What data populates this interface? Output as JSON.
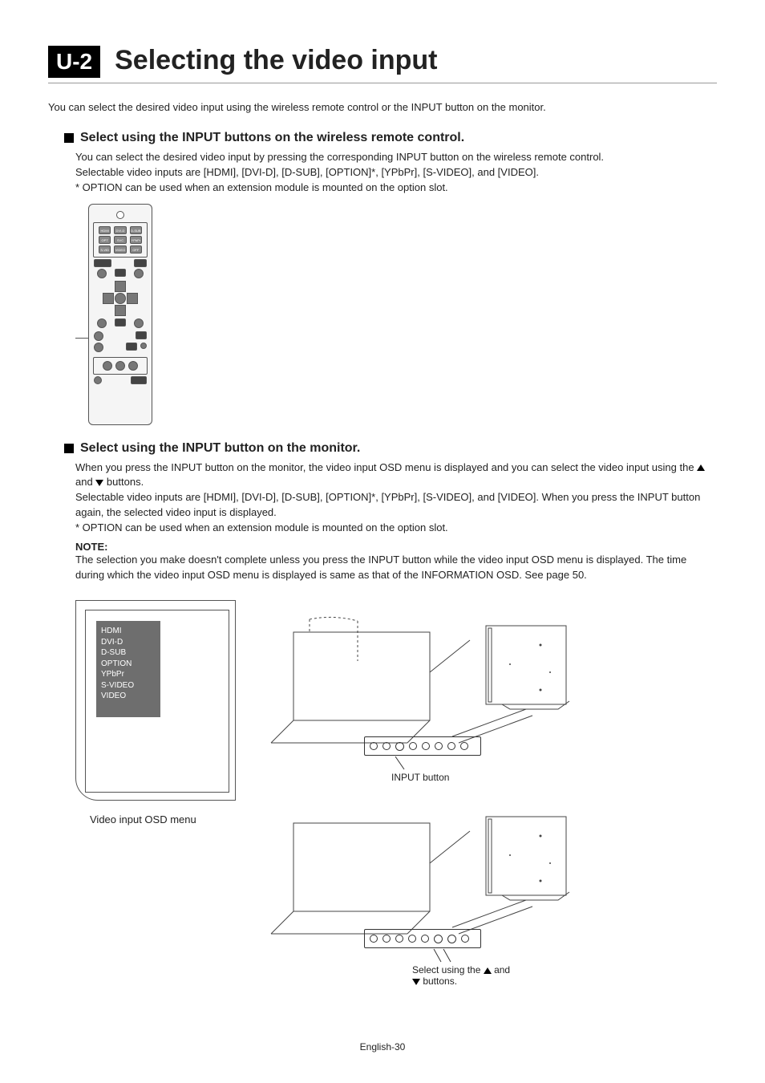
{
  "header": {
    "badge": "U-2",
    "title": "Selecting the video input"
  },
  "intro": "You can select the desired video input using the wireless remote control or the INPUT button on the monitor.",
  "section1": {
    "title": "Select using the INPUT buttons on the wireless remote control.",
    "p1": "You can select the desired video input by pressing the corresponding INPUT button on the wireless remote control.",
    "p2": "Selectable video inputs are [HDMI], [DVI-D], [D-SUB], [OPTION]*, [YPbPr], [S-VIDEO], and [VIDEO].",
    "p3": "* OPTION can be used when an extension module is mounted on the option slot."
  },
  "section2": {
    "title": "Select using the INPUT button on the monitor.",
    "p1a": "When you press the INPUT button on the monitor, the video input OSD menu is displayed and you can select the video input using the ",
    "p1b": " and ",
    "p1c": " buttons.",
    "p2": "Selectable video inputs are [HDMI], [DVI-D], [D-SUB], [OPTION]*, [YPbPr], [S-VIDEO], and [VIDEO]. When you press the INPUT button again, the selected video input is displayed.",
    "p3": "* OPTION can be used when an extension module is mounted on the option slot.",
    "note_label": "NOTE:",
    "note_body": "The selection you make doesn't complete unless you press the INPUT button while the video input OSD menu is displayed. The time during which the video input OSD menu is displayed is same as that of the INFORMATION OSD. See page 50."
  },
  "osd": {
    "items": [
      "HDMI",
      "DVI-D",
      "D-SUB",
      "OPTION",
      "YPbPr",
      "S-VIDEO",
      "VIDEO"
    ],
    "caption": "Video input OSD menu"
  },
  "panel1_label": "INPUT button",
  "panel2_label_a": "Select using the ",
  "panel2_label_b": " and ",
  "panel2_label_c": " buttons.",
  "footer": "English-30"
}
